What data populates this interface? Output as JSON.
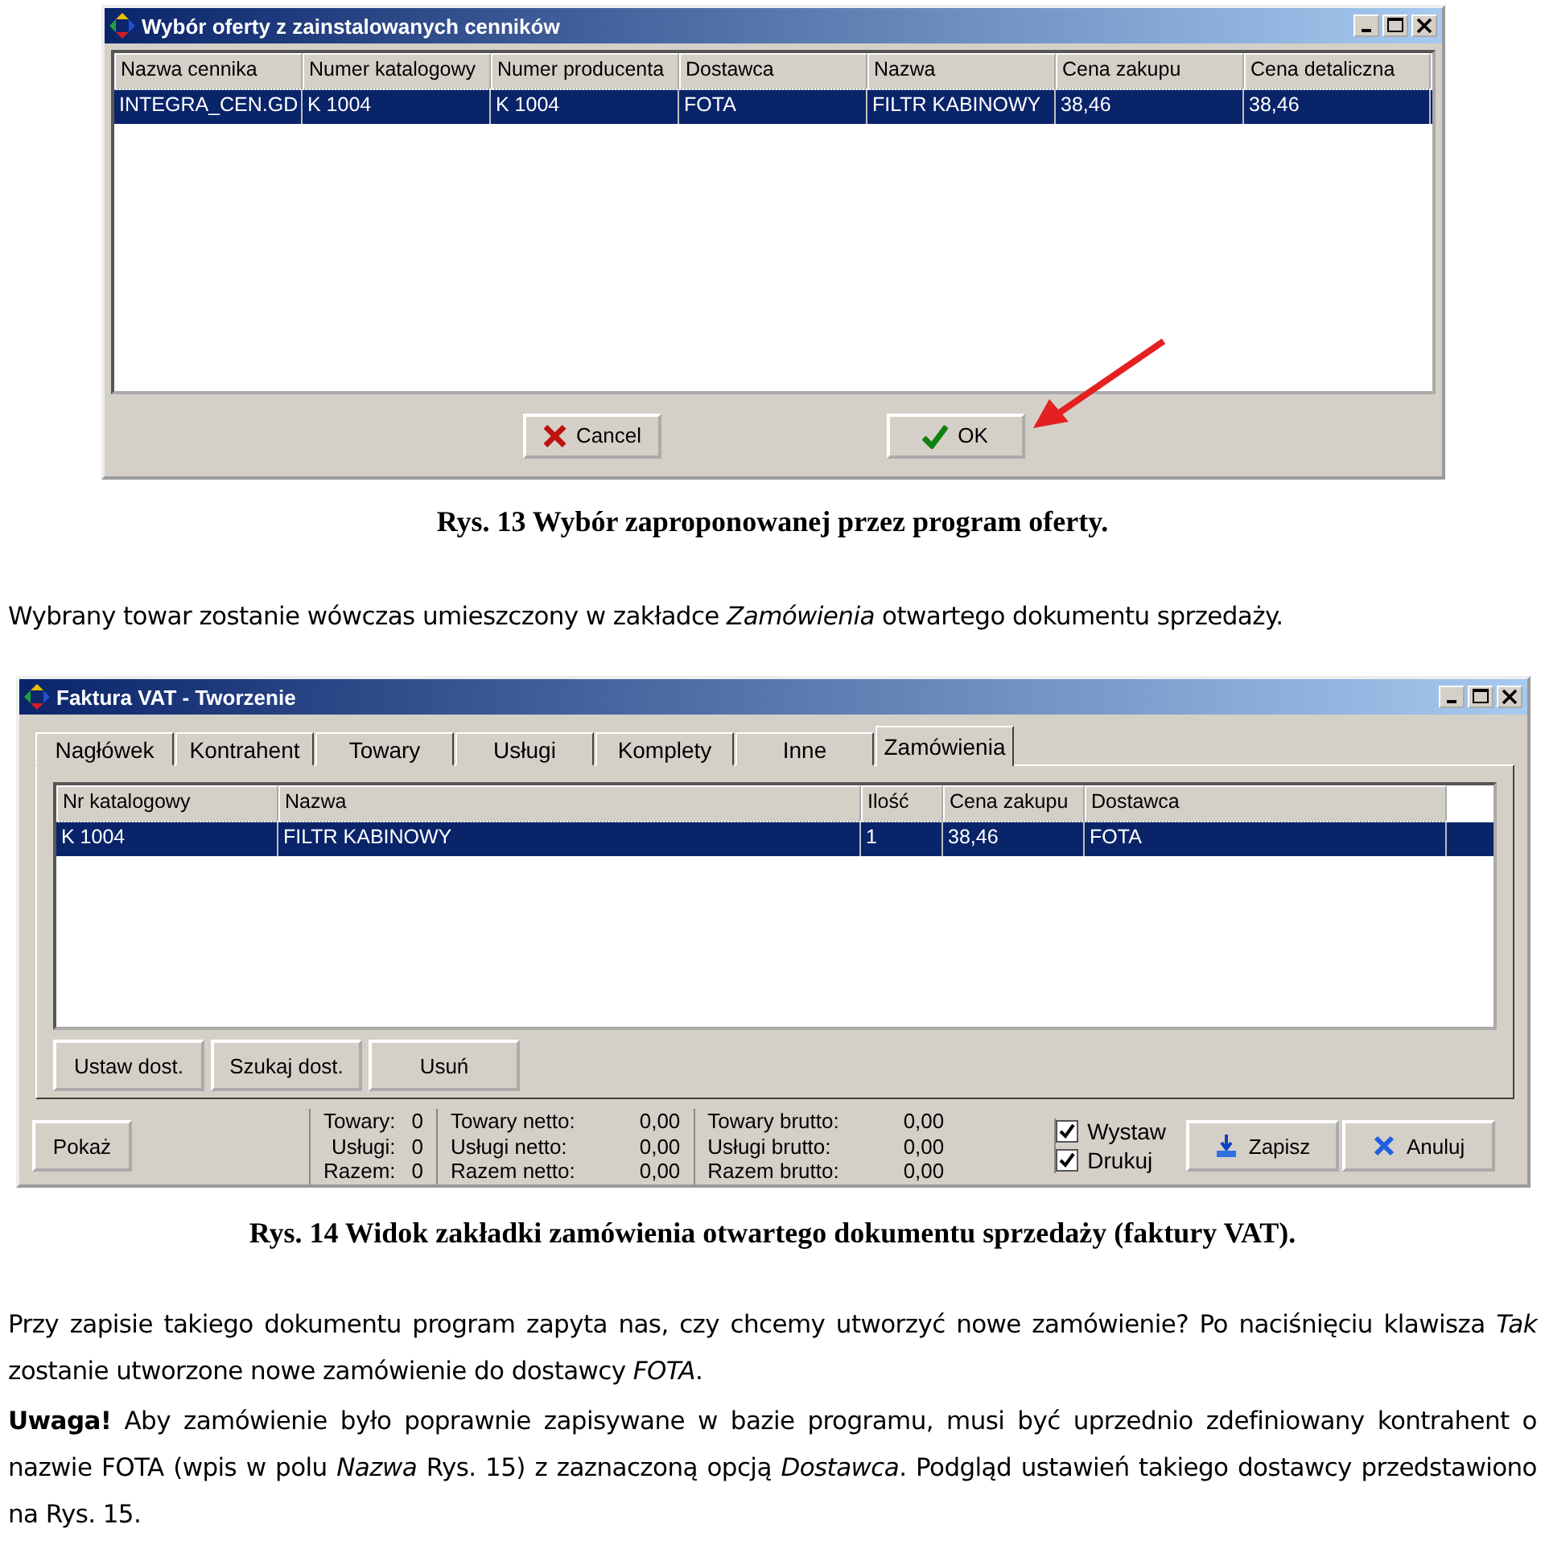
{
  "figure_1": {
    "window": {
      "title": "Wybór oferty z zainstalowanych cenników",
      "columns": [
        "Nazwa cennika",
        "Numer katalogowy",
        "Numer producenta",
        "Dostawca",
        "Nazwa",
        "Cena zakupu",
        "Cena detaliczna"
      ],
      "rows": [
        {
          "selected": true,
          "cells": [
            "INTEGRA_CEN.GD",
            "K 1004",
            "K 1004",
            "FOTA",
            "FILTR KABINOWY",
            "38,46",
            "38,46"
          ]
        }
      ],
      "buttons": [
        {
          "kind": "cancel",
          "label": "Cancel"
        },
        {
          "kind": "ok",
          "label": "OK"
        }
      ]
    },
    "caption": "Rys. 13 Wybór zaproponowanej przez program oferty."
  },
  "paragraph_1": "Wybrany towar zostanie wówczas umieszczony w zakładce *Zamówienia* otwartego dokumentu sprzedaży.",
  "figure_2": {
    "window": {
      "title": "Faktura VAT - Tworzenie",
      "tabs": [
        {
          "label": "Nagłówek",
          "selected": false
        },
        {
          "label": "Kontrahent",
          "selected": false
        },
        {
          "label": "Towary",
          "selected": false
        },
        {
          "label": "Usługi",
          "selected": false
        },
        {
          "label": "Komplety",
          "selected": false
        },
        {
          "label": "Inne",
          "selected": false
        },
        {
          "label": "Zamówienia",
          "selected": true
        }
      ],
      "columns": [
        "Nr katalogowy",
        "Nazwa",
        "Ilość",
        "Cena zakupu",
        "Dostawca"
      ],
      "rows": [
        {
          "selected": true,
          "cells": [
            "K 1004",
            "FILTR KABINOWY",
            "1",
            "38,46",
            "FOTA"
          ]
        }
      ],
      "tab_buttons": [
        "Ustaw dost.",
        "Szukaj dost.",
        "Usuń"
      ],
      "show_button": "Pokaż",
      "summary": [
        [
          {
            "label": "Towary:",
            "value": "0"
          },
          {
            "label": "Usługi:",
            "value": "0"
          },
          {
            "label": "Razem:",
            "value": "0"
          }
        ],
        [
          {
            "label": "Towary netto:",
            "value": "0,00"
          },
          {
            "label": "Usługi netto:",
            "value": "0,00"
          },
          {
            "label": "Razem netto:",
            "value": "0,00"
          }
        ],
        [
          {
            "label": "Towary brutto:",
            "value": "0,00"
          },
          {
            "label": "Usługi brutto:",
            "value": "0,00"
          },
          {
            "label": "Razem brutto:",
            "value": "0,00"
          }
        ]
      ],
      "checkboxes": [
        {
          "label": "Wystaw",
          "checked": true
        },
        {
          "label": "Drukuj",
          "checked": true
        }
      ],
      "buttons": [
        {
          "kind": "save",
          "label": "Zapisz"
        },
        {
          "kind": "cancel",
          "label": "Anuluj"
        }
      ]
    },
    "caption": "Rys. 14 Widok zakładki zamówienia otwartego dokumentu sprzedaży (faktury VAT)."
  },
  "paragraphs": [
    "Przy zapisie takiego dokumentu program zapyta nas, czy chcemy utworzyć nowe zamówienie? Po naciśnięciu klawisza *Tak* zostanie utworzone nowe zamówienie do dostawcy *FOTA*.",
    "**Uwaga!** Aby zamówienie było poprawnie zapisywane w bazie programu, musi być uprzednio zdefiniowany kontrahent o nazwie FOTA (wpis w polu *Nazwa* Rys. 15) z zaznaczoną opcją *Dostawca*. Podgląd ustawień takiego dostawcy przedstawiono na Rys. 15."
  ]
}
